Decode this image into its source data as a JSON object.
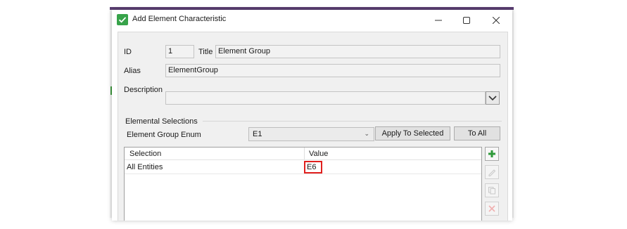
{
  "window": {
    "title": "Add Element Characteristic",
    "controls": {
      "minimize": "minimize",
      "maximize": "maximize",
      "close": "close"
    }
  },
  "form": {
    "id_label": "ID",
    "id_value": "1",
    "title_label": "Title",
    "title_value": "Element Group",
    "alias_label": "Alias",
    "alias_value": "ElementGroup",
    "description_label": "Description",
    "description_value": ""
  },
  "elemental": {
    "group_title": "Elemental Selections",
    "enum_label": "Element Group Enum",
    "enum_value": "E1",
    "apply_selected_label": "Apply To Selected",
    "to_all_label": "To All",
    "grid": {
      "columns": [
        "Selection",
        "Value"
      ],
      "rows": [
        {
          "selection": "All Entities",
          "value": "E6"
        }
      ]
    },
    "side_buttons": [
      "add-icon",
      "edit-icon",
      "copy-icon",
      "delete-icon"
    ]
  },
  "colors": {
    "accent_green": "#37a34a",
    "highlight_red": "#e0201e",
    "window_frame": "#5b3f73"
  }
}
